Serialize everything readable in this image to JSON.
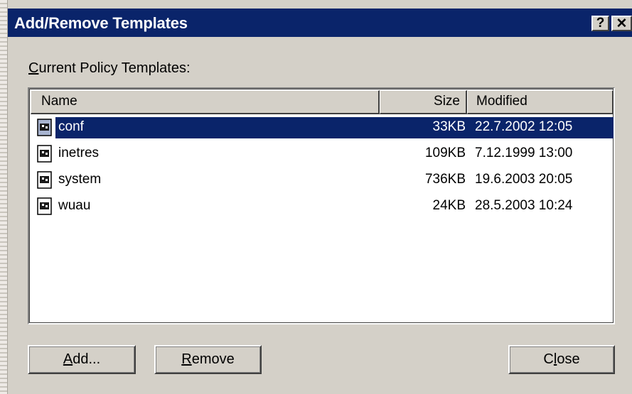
{
  "dialog": {
    "title": "Add/Remove Templates",
    "help_button": "?",
    "close_button": "✕"
  },
  "section_label_first": "C",
  "section_label_rest": "urrent Policy Templates:",
  "list": {
    "columns": {
      "name": "Name",
      "size": "Size",
      "modified": "Modified"
    },
    "rows": [
      {
        "name": "conf",
        "size": "33KB",
        "modified": "22.7.2002 12:05",
        "selected": true,
        "icon": "adm-file-icon"
      },
      {
        "name": "inetres",
        "size": "109KB",
        "modified": "7.12.1999 13:00",
        "selected": false,
        "icon": "adm-file-icon"
      },
      {
        "name": "system",
        "size": "736KB",
        "modified": "19.6.2003 20:05",
        "selected": false,
        "icon": "adm-file-icon"
      },
      {
        "name": "wuau",
        "size": "24KB",
        "modified": "28.5.2003 10:24",
        "selected": false,
        "icon": "adm-file-icon"
      }
    ]
  },
  "buttons": {
    "add_u": "A",
    "add_rest": "dd...",
    "remove_u": "R",
    "remove_rest": "emove",
    "close_first": "C",
    "close_u": "l",
    "close_rest": "ose"
  },
  "colors": {
    "titlebar": "#0a246a",
    "face": "#d4d0c8",
    "selection": "#0a246a"
  }
}
